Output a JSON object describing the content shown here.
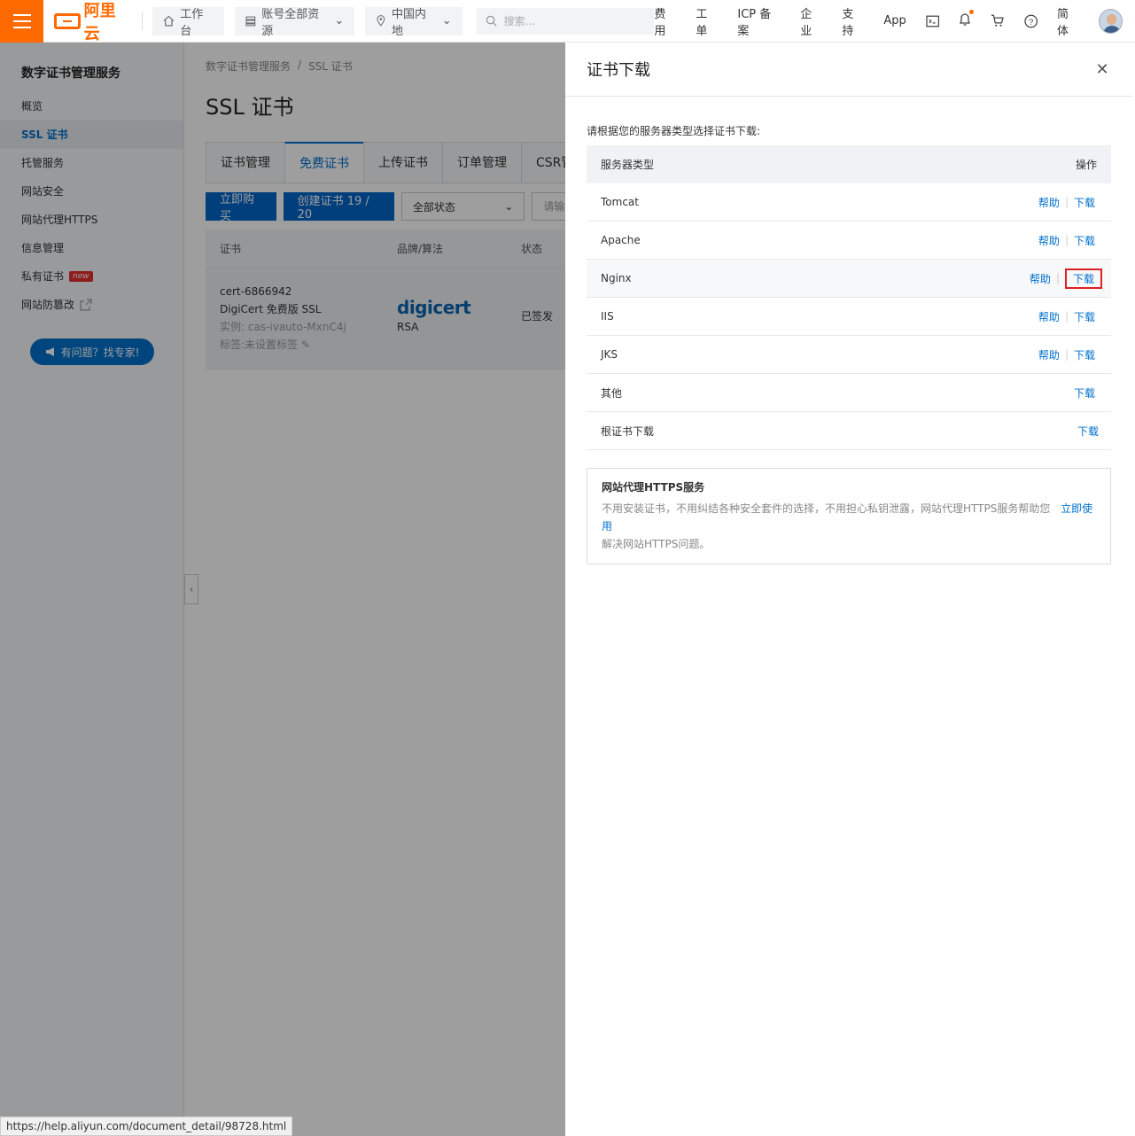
{
  "topbar": {
    "logo_text": "阿里云",
    "workbench": "工作台",
    "resources": "账号全部资源",
    "region": "中国内地",
    "search_placeholder": "搜索...",
    "links": [
      "费用",
      "工单",
      "ICP 备案",
      "企业",
      "支持",
      "App"
    ],
    "lang": "简体"
  },
  "sidebar": {
    "title": "数字证书管理服务",
    "items": [
      {
        "label": "概览"
      },
      {
        "label": "SSL 证书"
      },
      {
        "label": "托管服务"
      },
      {
        "label": "网站安全"
      },
      {
        "label": "网站代理HTTPS"
      },
      {
        "label": "信息管理"
      },
      {
        "label": "私有证书",
        "tag": "new"
      },
      {
        "label": "网站防篡改"
      }
    ],
    "expert_button": "有问题？找专家!"
  },
  "main": {
    "breadcrumb": [
      "数字证书管理服务",
      "/",
      "SSL 证书"
    ],
    "title": "SSL 证书",
    "tabs": [
      "证书管理",
      "免费证书",
      "上传证书",
      "订单管理",
      "CSR管"
    ],
    "buy_button": "立即购买",
    "create_button": "创建证书 19 / 20",
    "status_select": "全部状态",
    "input_stub": "请输",
    "table_headers": [
      "证书",
      "品牌/算法",
      "状态"
    ],
    "cert": {
      "id": "cert-6866942",
      "name": "DigiCert 免费版 SSL",
      "instance": "实例: cas-ivauto-MxnC4j",
      "tags": "标签:未设置标签",
      "brand": "digicert",
      "algorithm": "RSA",
      "status": "已签发"
    }
  },
  "drawer": {
    "title": "证书下载",
    "hint": "请根据您的服务器类型选择证书下载:",
    "col_server": "服务器类型",
    "col_action": "操作",
    "help_label": "帮助",
    "download_label": "下载",
    "rows": [
      {
        "server": "Tomcat"
      },
      {
        "server": "Apache"
      },
      {
        "server": "Nginx"
      },
      {
        "server": "IIS"
      },
      {
        "server": "JKS"
      },
      {
        "server": "其他"
      },
      {
        "server": "根证书下载"
      }
    ],
    "https_box": {
      "title": "网站代理HTTPS服务",
      "desc_line1": "不用安装证书，不用纠结各种安全套件的选择，不用担心私钥泄露，网站代理HTTPS服务帮助您",
      "link": "立即使用",
      "desc_line2": "解决网站HTTPS问题。"
    }
  },
  "statusbar": {
    "url": "https://help.aliyun.com/document_detail/98728.html"
  },
  "colors": {
    "brand_orange": "#ff6a00",
    "link_blue": "#0070cc",
    "highlight_red": "#e02020"
  }
}
